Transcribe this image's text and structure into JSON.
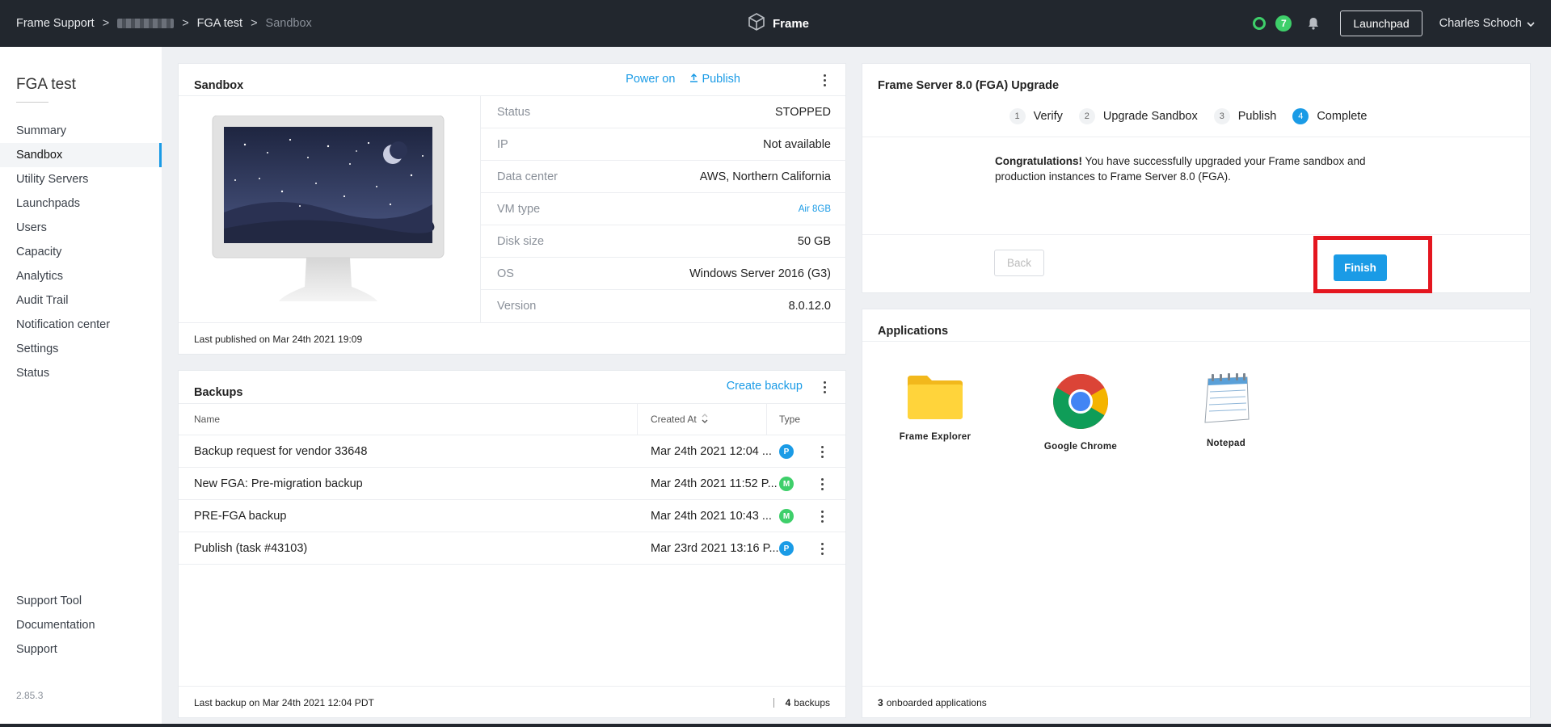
{
  "topbar": {
    "breadcrumb": [
      "Frame Support",
      "FGA test",
      "Sandbox"
    ],
    "separator": ">",
    "brand": "Frame",
    "notification_count": "7",
    "launchpad_label": "Launchpad",
    "user_name": "Charles Schoch"
  },
  "sidebar": {
    "title": "FGA test",
    "items": [
      "Summary",
      "Sandbox",
      "Utility Servers",
      "Launchpads",
      "Users",
      "Capacity",
      "Analytics",
      "Audit Trail",
      "Notification center",
      "Settings",
      "Status"
    ],
    "active": "Sandbox",
    "bottom_items": [
      "Support Tool",
      "Documentation",
      "Support"
    ],
    "version": "2.85.3"
  },
  "sandbox": {
    "title": "Sandbox",
    "power_on": "Power on",
    "publish": "Publish",
    "details": [
      {
        "key": "Status",
        "value": "STOPPED"
      },
      {
        "key": "IP",
        "value": "Not available"
      },
      {
        "key": "Data center",
        "value": "AWS, Northern California"
      },
      {
        "key": "VM type",
        "value": "Air 8GB"
      },
      {
        "key": "Disk size",
        "value": "50 GB"
      },
      {
        "key": "OS",
        "value": "Windows Server 2016 (G3)"
      },
      {
        "key": "Version",
        "value": "8.0.12.0"
      }
    ],
    "footer": "Last published on Mar 24th 2021 19:09"
  },
  "backups": {
    "title": "Backups",
    "create_label": "Create backup",
    "columns": [
      "Name",
      "Created At",
      "Type"
    ],
    "rows": [
      {
        "name": "Backup request for vendor 33648",
        "created": "Mar 24th 2021 12:04 ...",
        "type": "P"
      },
      {
        "name": "New FGA: Pre-migration backup",
        "created": "Mar 24th 2021 11:52 P...",
        "type": "M"
      },
      {
        "name": "PRE-FGA backup",
        "created": "Mar 24th 2021 10:43 ...",
        "type": "M"
      },
      {
        "name": "Publish (task #43103)",
        "created": "Mar 23rd 2021 13:16 P...",
        "type": "P"
      }
    ],
    "footer_left": "Last backup on Mar 24th 2021 12:04 PDT",
    "footer_count": "4",
    "footer_count_label": "backups"
  },
  "upgrade": {
    "title": "Frame Server 8.0 (FGA) Upgrade",
    "steps": [
      {
        "num": "1",
        "label": "Verify"
      },
      {
        "num": "2",
        "label": "Upgrade Sandbox"
      },
      {
        "num": "3",
        "label": "Publish"
      },
      {
        "num": "4",
        "label": "Complete"
      }
    ],
    "message_bold": "Congratulations!",
    "message": " You have successfully upgraded your Frame sandbox and production instances to Frame Server 8.0 (FGA).",
    "back_label": "Back",
    "finish_label": "Finish"
  },
  "applications": {
    "title": "Applications",
    "apps": [
      "Frame Explorer",
      "Google Chrome",
      "Notepad"
    ],
    "footer_count": "3",
    "footer_label": "onboarded applications"
  },
  "colors": {
    "accent": "#1a9be6",
    "success": "#3ecf6a",
    "highlight": "#e4161f",
    "topbar": "#22272e"
  }
}
